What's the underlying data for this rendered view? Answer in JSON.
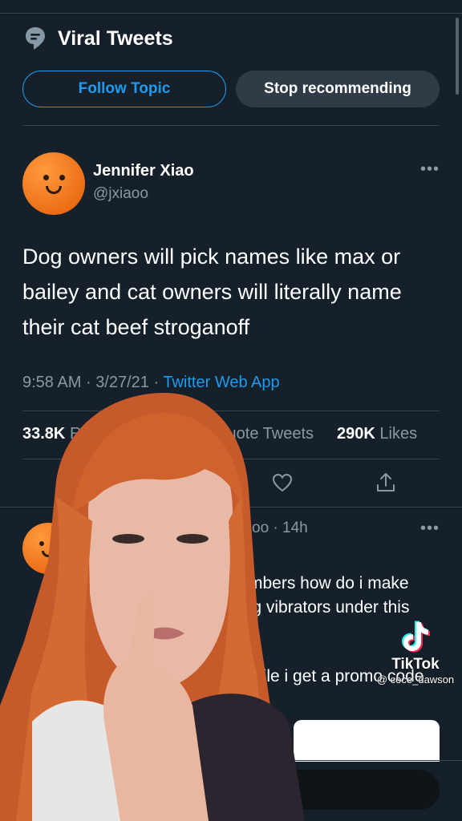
{
  "topic": {
    "title": "Viral Tweets",
    "follow_label": "Follow Topic",
    "stop_label": "Stop recommending",
    "icon": "topic-icon"
  },
  "tweet": {
    "author_name": "Jennifer Xiao",
    "author_handle": "@jxiaoo",
    "text": "Dog owners will pick names like max or bailey and cat owners will literally name their cat beef stroganoff",
    "time": "9:58 AM",
    "date": "3/27/21",
    "separator": "·",
    "client": "Twitter Web App",
    "retweets_count": "33.8K",
    "retweets_partial": "R",
    "quote_tweets_label": "Quote Tweets",
    "likes_count": "290K",
    "likes_label": "Likes"
  },
  "reply": {
    "meta": "oo · 14h",
    "line1": "mbers how do i make",
    "line2": "ing vibrators under this",
    "line3": "hile i get a promo code"
  },
  "watermark": {
    "brand": "TikTok",
    "username": "@ cece_dawson"
  },
  "colors": {
    "background": "#15202b",
    "accent": "#1d9bf0",
    "muted_text": "#8899a6",
    "divider": "#38444d"
  }
}
